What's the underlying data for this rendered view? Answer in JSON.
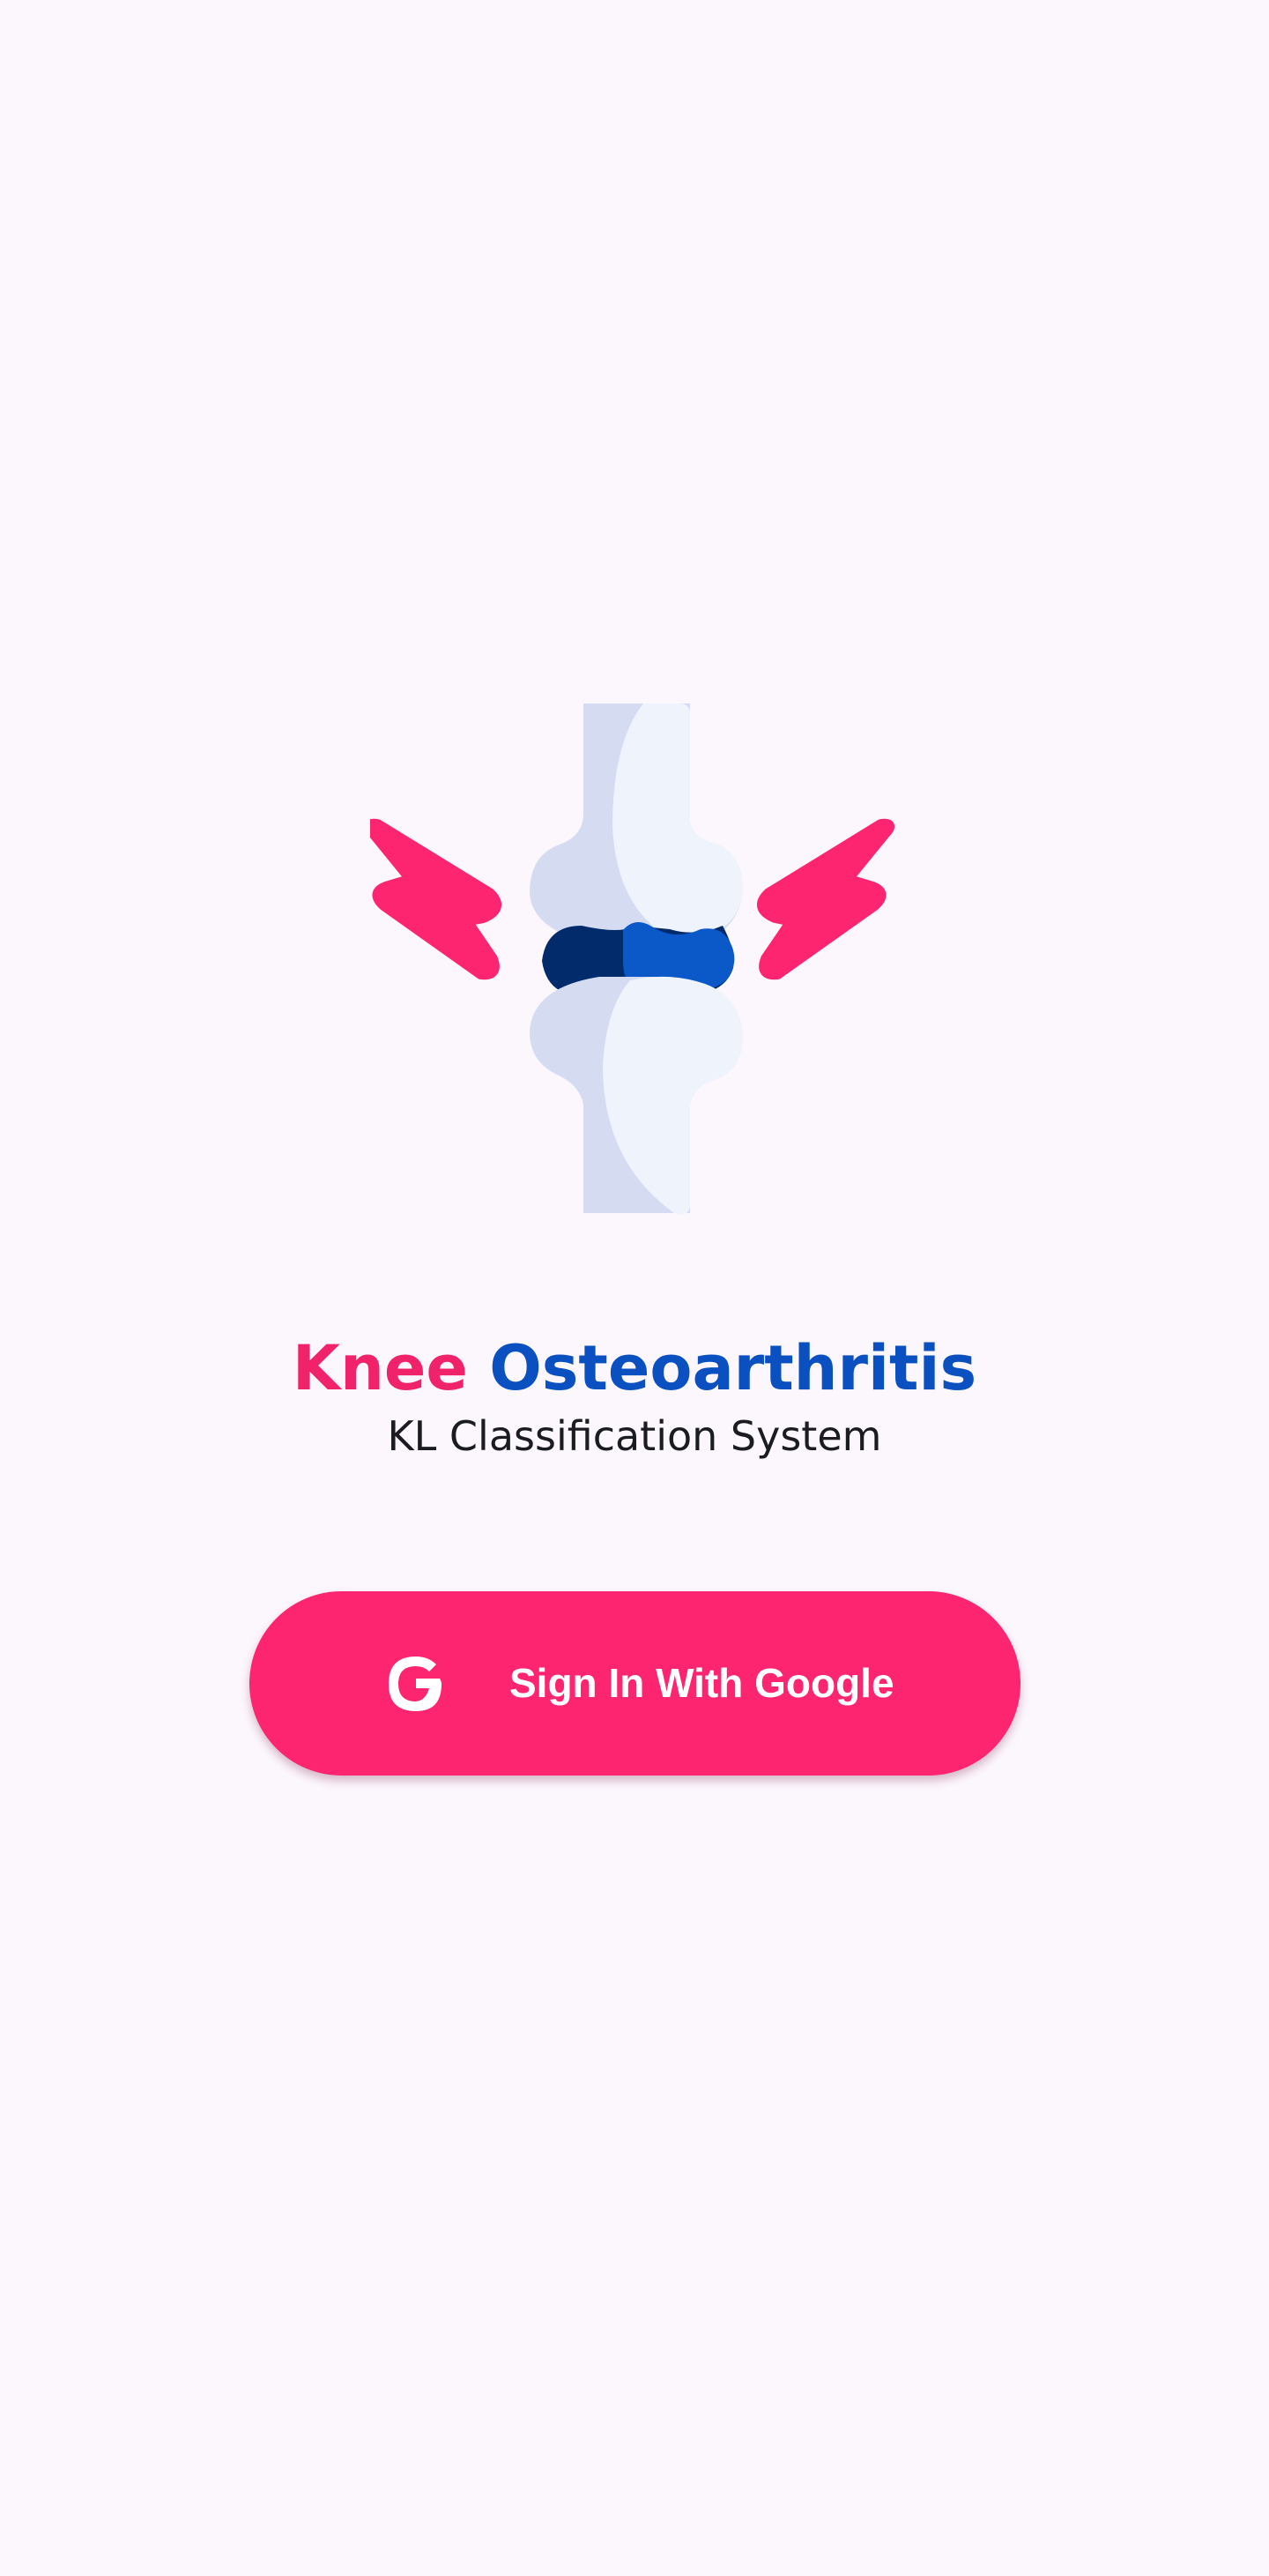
{
  "app": {
    "title_part1": "Knee",
    "title_part2": "Osteoarthritis",
    "subtitle": "KL Classification System"
  },
  "signin_button": {
    "label": "Sign In With Google",
    "icon": "google-g-icon"
  },
  "logo": {
    "icon": "knee-joint-pain-icon"
  },
  "colors": {
    "background": "#fcf6fd",
    "accent_pink": "#fd2470",
    "title_pink": "#f0226a",
    "title_blue": "#0b50c0",
    "bone_light": "#eef3fc",
    "bone_shade": "#d5dcf2",
    "cartilage_dark": "#022b6c",
    "cartilage_blue": "#0b59c8"
  }
}
